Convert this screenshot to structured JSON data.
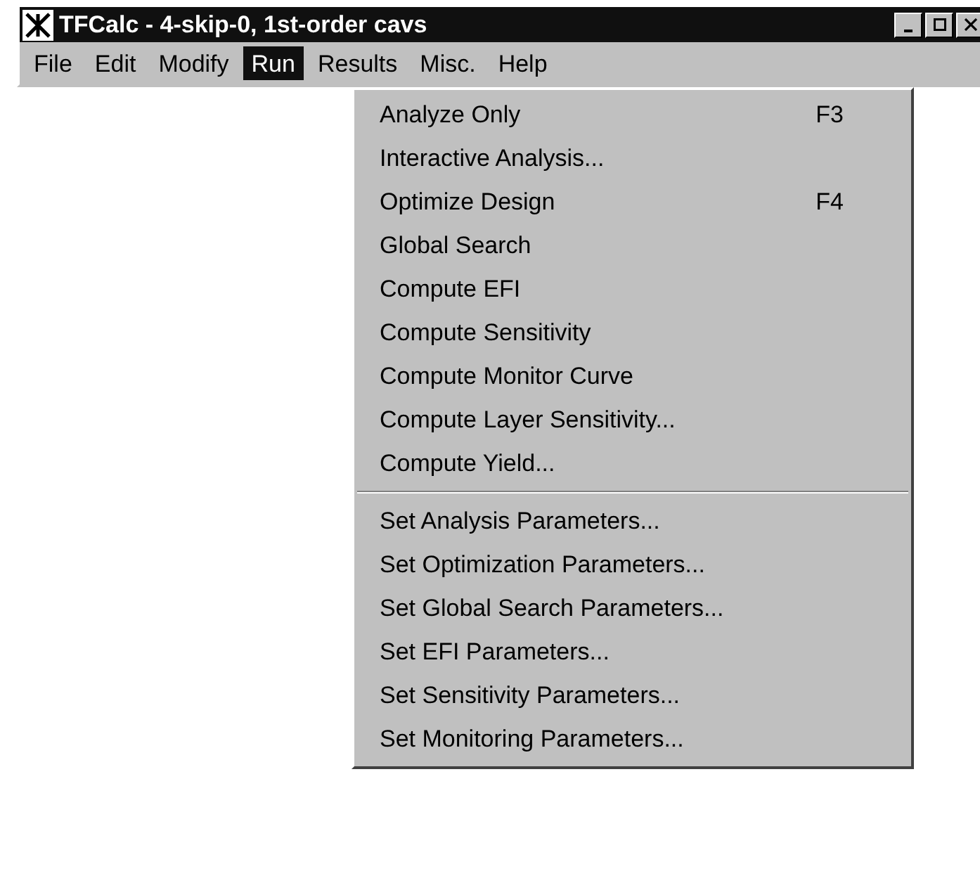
{
  "window": {
    "title": "TFCalc - 4-skip-0, 1st-order cavs"
  },
  "menu_bar": [
    {
      "label": "File",
      "selected": false
    },
    {
      "label": "Edit",
      "selected": false
    },
    {
      "label": "Modify",
      "selected": false
    },
    {
      "label": "Run",
      "selected": true
    },
    {
      "label": "Results",
      "selected": false
    },
    {
      "label": "Misc.",
      "selected": false
    },
    {
      "label": "Help",
      "selected": false
    }
  ],
  "run_menu": [
    [
      {
        "label": "Analyze Only",
        "shortcut": "F3"
      },
      {
        "label": "Interactive Analysis..."
      },
      {
        "label": "Optimize Design",
        "shortcut": "F4"
      },
      {
        "label": "Global Search"
      },
      {
        "label": "Compute EFI"
      },
      {
        "label": "Compute Sensitivity"
      },
      {
        "label": "Compute Monitor Curve"
      },
      {
        "label": "Compute Layer Sensitivity..."
      },
      {
        "label": "Compute Yield..."
      }
    ],
    [
      {
        "label": "Set Analysis Parameters..."
      },
      {
        "label": "Set Optimization Parameters..."
      },
      {
        "label": "Set Global Search Parameters..."
      },
      {
        "label": "Set EFI Parameters..."
      },
      {
        "label": "Set Sensitivity Parameters..."
      },
      {
        "label": "Set Monitoring Parameters..."
      }
    ]
  ]
}
